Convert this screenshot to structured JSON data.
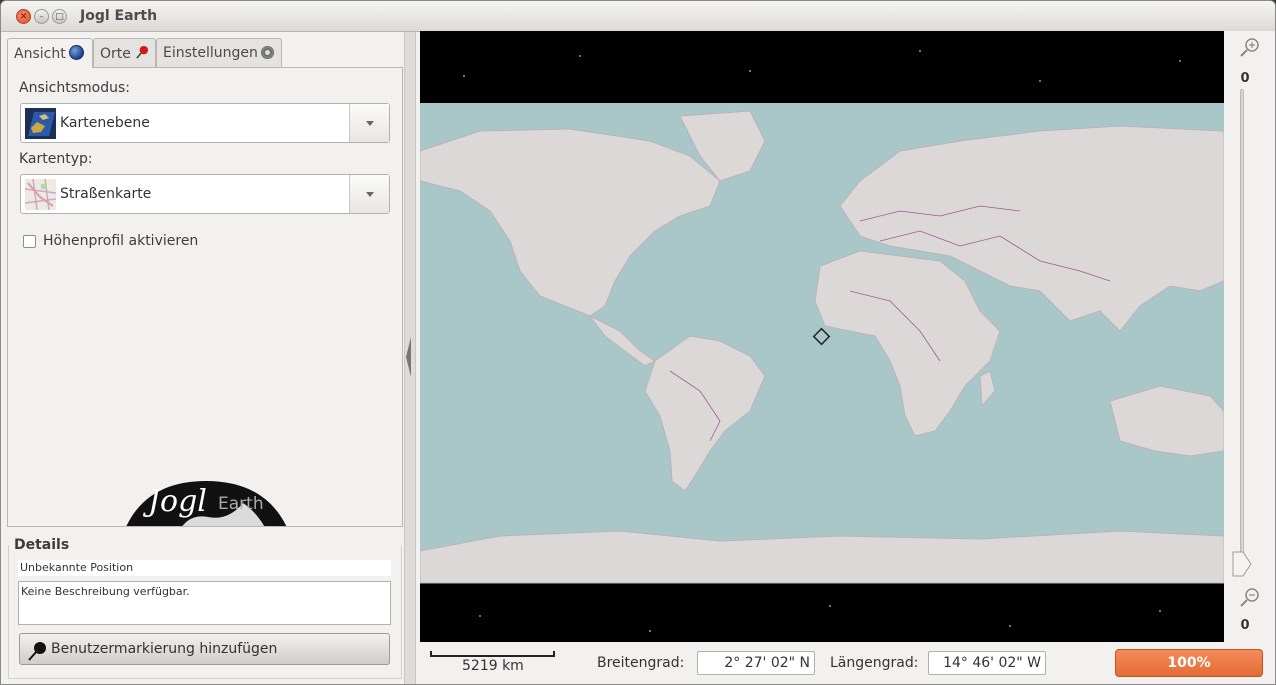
{
  "window": {
    "title": "Jogl Earth"
  },
  "tabs": [
    {
      "label": "Ansicht",
      "icon": "globe-icon",
      "active": true
    },
    {
      "label": "Orte",
      "icon": "pin-icon",
      "active": false
    },
    {
      "label": "Einstellungen",
      "icon": "gear-icon",
      "active": false
    }
  ],
  "view": {
    "mode_label": "Ansichtsmodus:",
    "mode_value": "Kartenebene",
    "maptype_label": "Kartentyp:",
    "maptype_value": "Straßenkarte",
    "elevation_label": "Höhenprofil aktivieren",
    "elevation_checked": false
  },
  "logo": {
    "text": "Jogl Earth"
  },
  "details": {
    "title": "Details",
    "position": "Unbekannte Position",
    "description": "Keine Beschreibung verfügbar.",
    "add_button": "Benutzermarkierung hinzufügen"
  },
  "zoom": {
    "top_value": "0",
    "bottom_value": "0",
    "level": 0.0
  },
  "status": {
    "scale": "5219 km",
    "lat_label": "Breitengrad:",
    "lat_value": "2° 27' 02\" N",
    "lon_label": "Längengrad:",
    "lon_value": "14° 46' 02\" W",
    "progress": "100%"
  },
  "colors": {
    "progress": "#e8733c",
    "ocean": "#9fc3c6",
    "land": "#dedad8",
    "borders": "#7a2a6e"
  }
}
